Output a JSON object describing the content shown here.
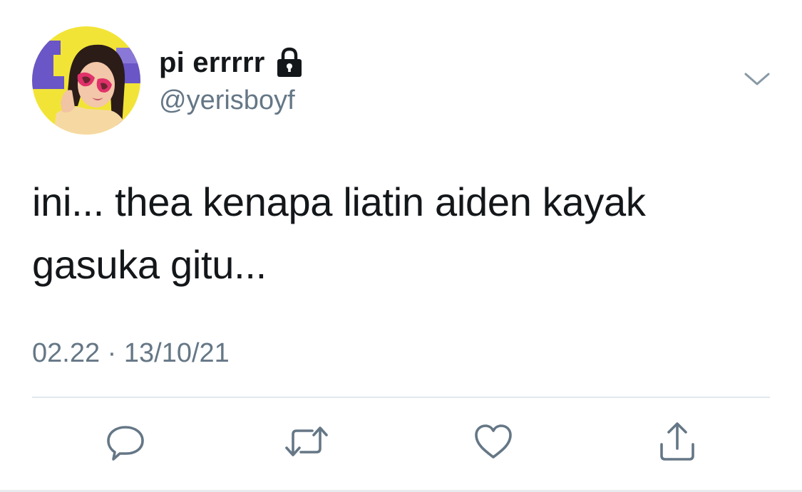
{
  "tweet": {
    "display_name": "pi errrrr",
    "username": "@yerisboyf",
    "protected_icon": "lock-icon",
    "text_line1": "ini... thea kenapa liatin aiden kayak",
    "text_line2": "gasuka gitu...",
    "timestamp": "02.22 · 13/10/21"
  },
  "actions": {
    "reply_icon": "speech-bubble-icon",
    "retweet_icon": "retweet-arrows-icon",
    "like_icon": "heart-icon",
    "share_icon": "share-upload-icon"
  },
  "colors": {
    "text": "#14171a",
    "secondary": "#657786",
    "divider": "#e1e8ed",
    "avatar_yellow": "#f2e437",
    "avatar_purple": "#6a56c7",
    "sunglasses_pink": "#e0316b"
  }
}
